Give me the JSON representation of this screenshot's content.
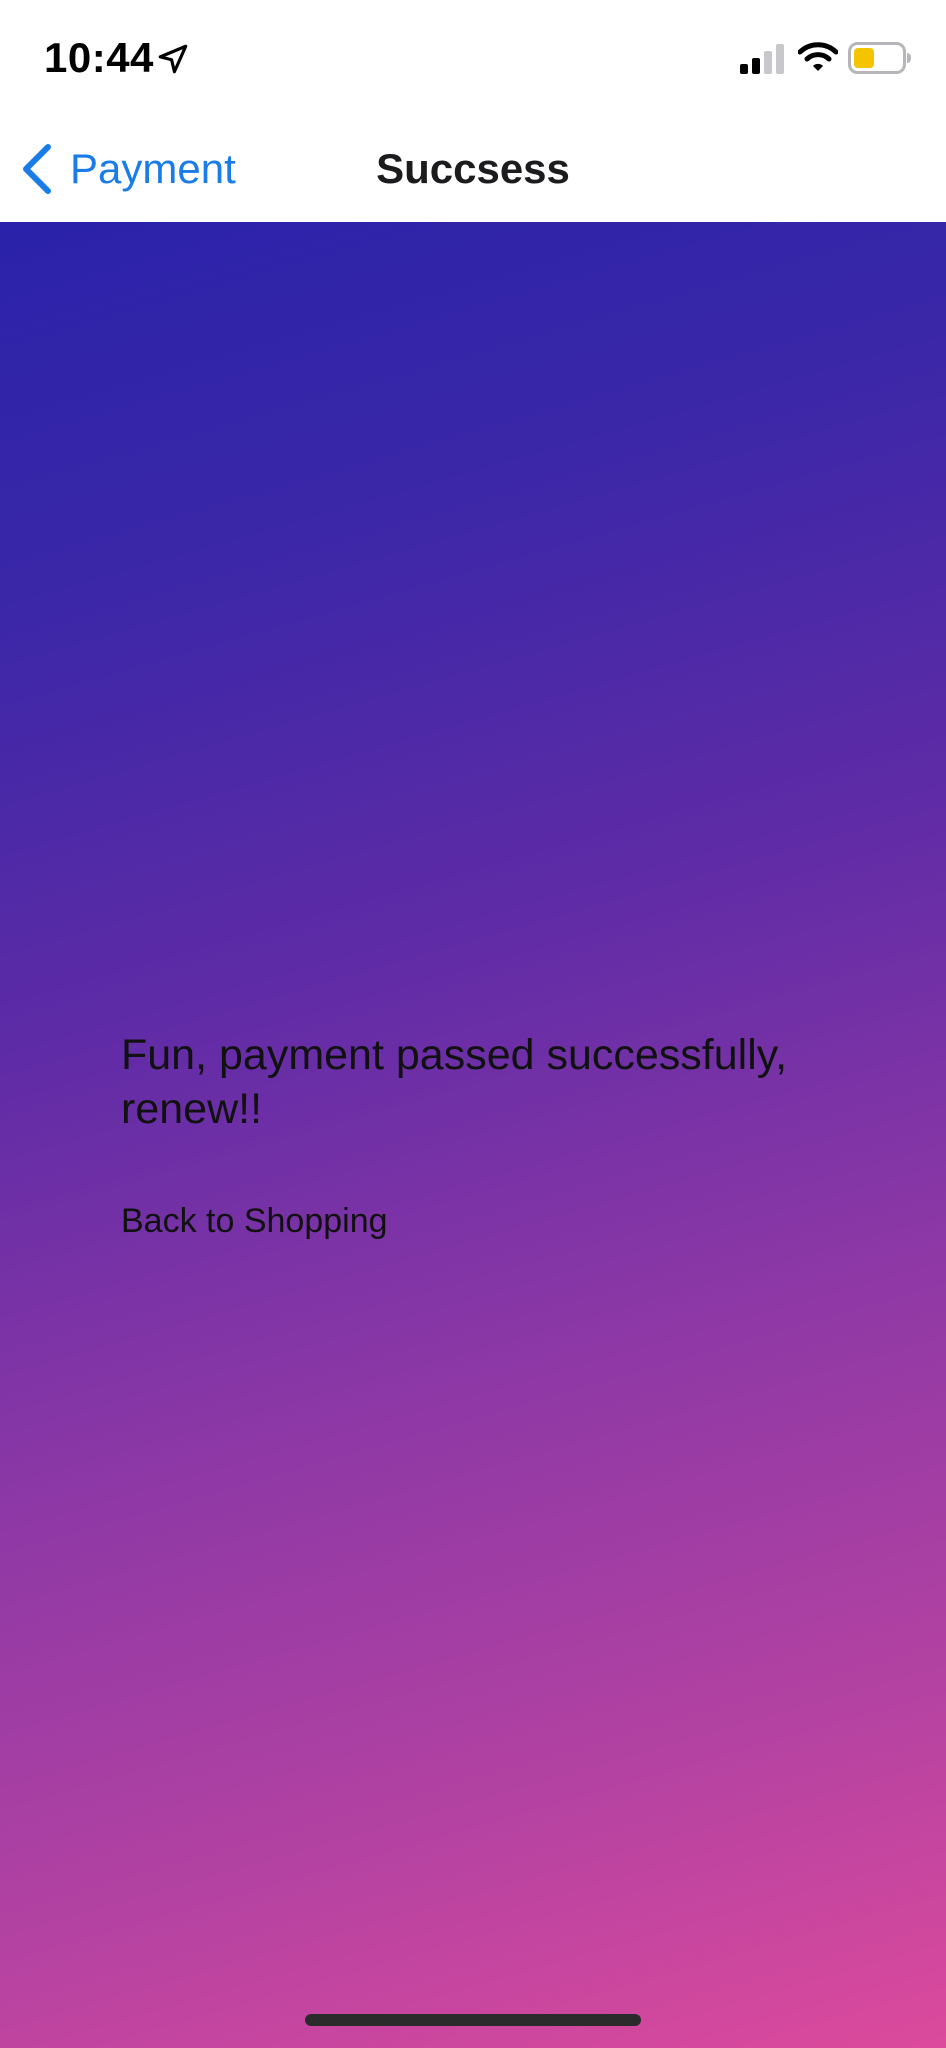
{
  "status_bar": {
    "time": "10:44",
    "location_icon": "location-arrow-icon",
    "signal_icon": "cellular-signal-icon",
    "wifi_icon": "wifi-icon",
    "battery_icon": "battery-icon",
    "battery_color": "#f5c400"
  },
  "nav_bar": {
    "back_label": "Payment",
    "back_icon": "chevron-left-icon",
    "title": "Succsess",
    "accent_color": "#1a7ce6"
  },
  "content": {
    "message": "Fun, payment passed successfully, renew!!",
    "back_to_shopping_label": "Back to Shopping",
    "gradient_start_color": "#2a22aa",
    "gradient_end_color": "#dc4a9c"
  }
}
